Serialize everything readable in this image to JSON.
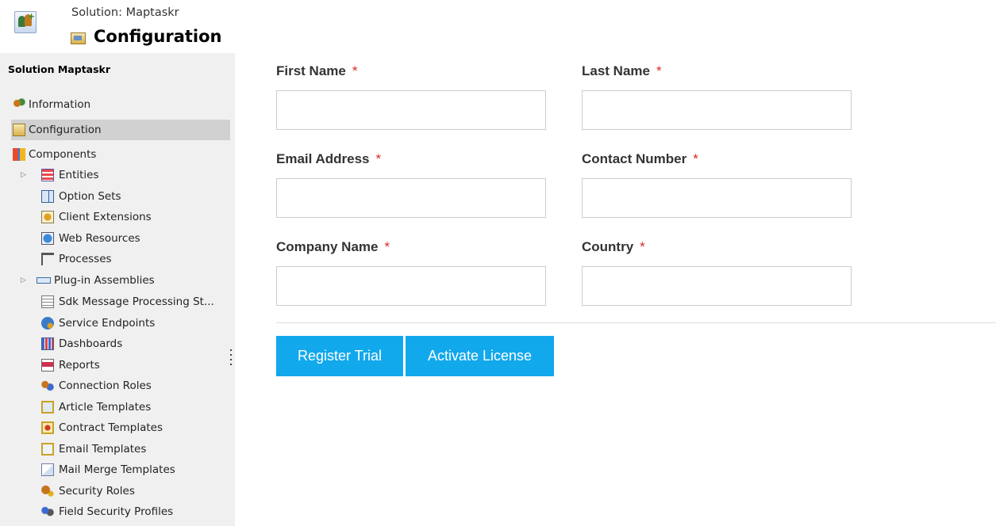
{
  "header": {
    "solution_label": "Solution: Maptaskr",
    "page_title": "Configuration"
  },
  "sidebar": {
    "heading": "Solution Maptaskr",
    "items": [
      {
        "label": "Information",
        "icon": "information-icon"
      },
      {
        "label": "Configuration",
        "icon": "configuration-icon",
        "selected": true
      },
      {
        "label": "Components",
        "icon": "components-icon"
      },
      {
        "label": "Entities",
        "icon": "entities-icon",
        "expandable": true
      },
      {
        "label": "Option Sets",
        "icon": "option-sets-icon"
      },
      {
        "label": "Client Extensions",
        "icon": "client-extensions-icon"
      },
      {
        "label": "Web Resources",
        "icon": "web-resources-icon"
      },
      {
        "label": "Processes",
        "icon": "processes-icon"
      },
      {
        "label": "Plug-in Assemblies",
        "icon": "plugin-assemblies-icon",
        "expandable": true
      },
      {
        "label": "Sdk Message Processing St...",
        "icon": "sdk-message-icon"
      },
      {
        "label": "Service Endpoints",
        "icon": "service-endpoints-icon"
      },
      {
        "label": "Dashboards",
        "icon": "dashboards-icon"
      },
      {
        "label": "Reports",
        "icon": "reports-icon"
      },
      {
        "label": "Connection Roles",
        "icon": "connection-roles-icon"
      },
      {
        "label": "Article Templates",
        "icon": "article-templates-icon"
      },
      {
        "label": "Contract Templates",
        "icon": "contract-templates-icon"
      },
      {
        "label": "Email Templates",
        "icon": "email-templates-icon"
      },
      {
        "label": "Mail Merge Templates",
        "icon": "mail-merge-templates-icon"
      },
      {
        "label": "Security Roles",
        "icon": "security-roles-icon"
      },
      {
        "label": "Field Security Profiles",
        "icon": "field-security-profiles-icon"
      }
    ]
  },
  "form": {
    "required_marker": "*",
    "first_name": {
      "label": "First Name",
      "value": ""
    },
    "last_name": {
      "label": "Last Name",
      "value": ""
    },
    "email": {
      "label": "Email Address",
      "value": ""
    },
    "contact_number": {
      "label": "Contact Number",
      "value": ""
    },
    "company_name": {
      "label": "Company Name",
      "value": ""
    },
    "country": {
      "label": "Country",
      "value": ""
    }
  },
  "actions": {
    "register_trial": "Register Trial",
    "activate_license": "Activate License"
  },
  "colors": {
    "accent": "#12a8ec",
    "required": "#d9291c",
    "sidebar_bg": "#f0f0f0",
    "selected_bg": "#d1d1d1"
  }
}
